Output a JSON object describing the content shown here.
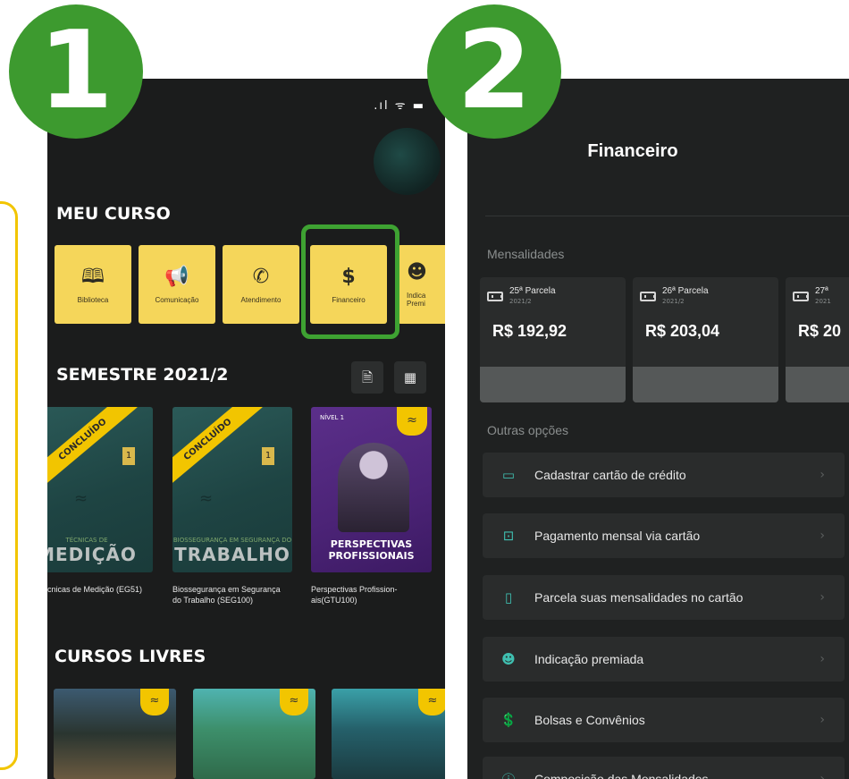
{
  "badges": {
    "one": "1",
    "two": "2"
  },
  "phone1": {
    "status_icons": ".ıl ᯤ ▬",
    "meu_curso_title": "MEU CURSO",
    "tiles": [
      {
        "icon": "book-icon",
        "glyph": "🕮",
        "label": "Biblioteca"
      },
      {
        "icon": "megaphone-icon",
        "glyph": "📢",
        "label": "Comunicação"
      },
      {
        "icon": "phone-icon",
        "glyph": "✆",
        "label": "Atendimento"
      },
      {
        "icon": "dollar-icon",
        "glyph": "$",
        "label": "Financeiro"
      },
      {
        "icon": "gift-icon",
        "glyph": "☻",
        "label": "Indica Premi"
      }
    ],
    "semestre_title": "SEMESTRE 2021/2",
    "semestre_buttons": [
      {
        "icon": "download-file-icon",
        "glyph": "🗎"
      },
      {
        "icon": "calendar-icon",
        "glyph": "▦"
      }
    ],
    "courses": [
      {
        "ribbon": "CONCLUÍDO",
        "num": "1",
        "small": "TÉCNICAS DE",
        "big": "MEDIÇÃO",
        "caption": "cnicas de Medição (EG51)"
      },
      {
        "ribbon": "CONCLUÍDO",
        "num": "1",
        "small": "BIOSSEGURANÇA EM SEGURANÇA DO",
        "big": "TRABALHO",
        "caption": "Biossegurança em Segurança do Trabalho (SEG100)"
      },
      {
        "tag": "NÍVEL 1",
        "title": "PERSPECTIVAS PROFISSIONAIS",
        "caption": "Perspectivas Profission- ais(GTU100)"
      }
    ],
    "cursos_livres_title": "CURSOS LIVRES"
  },
  "phone2": {
    "title": "Financeiro",
    "mensalidades_label": "Mensalidades",
    "parcelas": [
      {
        "label": "25ª Parcela",
        "semester": "2021/2",
        "value": "R$ 192,92"
      },
      {
        "label": "26ª Parcela",
        "semester": "2021/2",
        "value": "R$ 203,04"
      },
      {
        "label": "27ª",
        "semester": "2021",
        "value": "R$ 20"
      }
    ],
    "outras_label": "Outras opções",
    "options": [
      {
        "icon": "credit-card-icon",
        "glyph": "▭",
        "label": "Cadastrar cartão de crédito"
      },
      {
        "icon": "money-icon",
        "glyph": "⊡",
        "label": "Pagamento mensal via cartão"
      },
      {
        "icon": "installment-card-icon",
        "glyph": "▯",
        "label": "Parcela suas mensalidades no cartão"
      },
      {
        "icon": "referral-icon",
        "glyph": "☻",
        "label": "Indicação premiada"
      },
      {
        "icon": "scholarship-icon",
        "glyph": "💲",
        "label": "Bolsas e Convênios"
      },
      {
        "icon": "info-icon",
        "glyph": "ⓘ",
        "label": "Composição das Mensalidades"
      }
    ],
    "chevron": "›"
  }
}
